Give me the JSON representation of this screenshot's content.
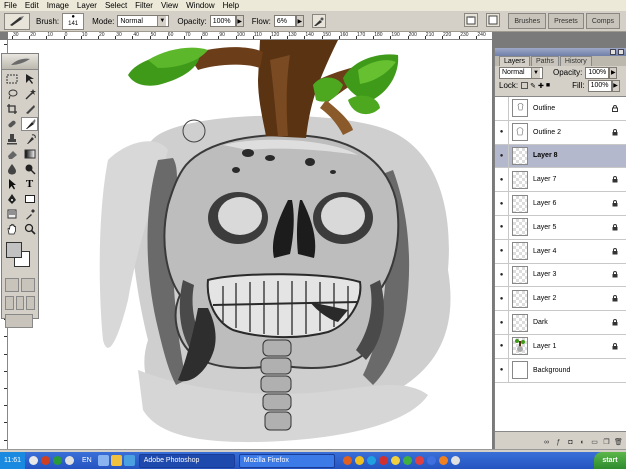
{
  "menu": [
    "File",
    "Edit",
    "Image",
    "Layer",
    "Select",
    "Filter",
    "View",
    "Window",
    "Help"
  ],
  "options": {
    "brush_label": "Brush:",
    "brush_size": "141",
    "mode_label": "Mode:",
    "mode_value": "Normal",
    "opacity_label": "Opacity:",
    "opacity_value": "100%",
    "flow_label": "Flow:",
    "flow_value": "6%",
    "wells": [
      "Brushes",
      "Presets",
      "Comps"
    ]
  },
  "ruler_ticks": [
    "30",
    "20",
    "10",
    "0",
    "10",
    "20",
    "30",
    "40",
    "50",
    "60",
    "70",
    "80",
    "90",
    "100",
    "110",
    "120",
    "130",
    "140",
    "150",
    "160",
    "170",
    "180",
    "190",
    "200",
    "210",
    "220",
    "230",
    "240"
  ],
  "layers_panel": {
    "tabs": [
      "Layers",
      "Paths",
      "History"
    ],
    "blend_mode": "Normal",
    "opacity_label": "Opacity:",
    "opacity_value": "100%",
    "lock_label": "Lock:",
    "fill_label": "Fill:",
    "fill_value": "100%",
    "layers": [
      {
        "name": "Outline",
        "visible": false,
        "selected": false,
        "thumb": "outline"
      },
      {
        "name": "Outline 2",
        "visible": true,
        "selected": false,
        "thumb": "outline"
      },
      {
        "name": "Layer 8",
        "visible": true,
        "selected": true,
        "thumb": "transparent"
      },
      {
        "name": "Layer 7",
        "visible": true,
        "selected": false,
        "thumb": "transparent"
      },
      {
        "name": "Layer 6",
        "visible": true,
        "selected": false,
        "thumb": "transparent"
      },
      {
        "name": "Layer 5",
        "visible": true,
        "selected": false,
        "thumb": "transparent"
      },
      {
        "name": "Layer 4",
        "visible": true,
        "selected": false,
        "thumb": "transparent"
      },
      {
        "name": "Layer 3",
        "visible": true,
        "selected": false,
        "thumb": "transparent"
      },
      {
        "name": "Layer 2",
        "visible": true,
        "selected": false,
        "thumb": "transparent"
      },
      {
        "name": "Dark",
        "visible": true,
        "selected": false,
        "thumb": "transparent"
      },
      {
        "name": "Layer 1",
        "visible": true,
        "selected": false,
        "thumb": "tree"
      },
      {
        "name": "Background",
        "visible": true,
        "selected": false,
        "thumb": "plain"
      }
    ]
  },
  "taskbar": {
    "clock": "11:61",
    "language": "EN",
    "tasks": [
      "Adobe Photoshop",
      "Mozilla Firefox"
    ],
    "start": "start"
  },
  "colors": {
    "foreground": "#c2c2c2",
    "background": "#ffffff",
    "selected_layer": "#b4b8cc",
    "leaf_green": "#3f9a1a",
    "trunk_brown": "#5a3312"
  }
}
